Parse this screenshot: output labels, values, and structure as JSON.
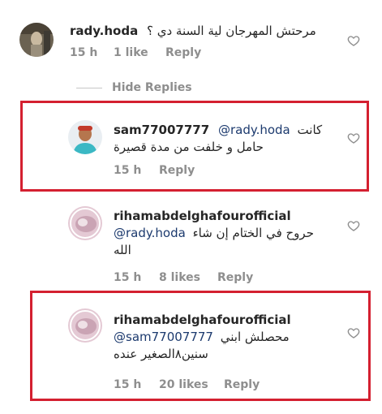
{
  "hide_replies_label": "Hide Replies",
  "comments": [
    {
      "username": "rady.hoda",
      "text": "مرحتش المهرجان لية السنة دي ؟",
      "time": "15 h",
      "likes": "1 like",
      "reply": "Reply"
    },
    {
      "username": "sam77007777",
      "mention": "@rady.hoda",
      "text_line1": "كانت",
      "text_line2": "حامل و خلفت من مدة قصيرة",
      "time": "15 h",
      "reply": "Reply"
    },
    {
      "username": "rihamabdelghafourofficial",
      "mention": "@rady.hoda",
      "text_line1": "حروح في الختام إن شاء",
      "text_line2": "الله",
      "time": "15 h",
      "likes": "8 likes",
      "reply": "Reply"
    },
    {
      "username": "rihamabdelghafourofficial",
      "mention": "@sam77007777",
      "text_line1": "محصلش ابني",
      "text_line2": "سنين٨الصغير عنده",
      "time": "15 h",
      "likes": "20 likes",
      "reply": "Reply"
    }
  ],
  "icons": {
    "like": "heart-outline-icon"
  },
  "colors": {
    "highlight": "#d42030",
    "meta": "#8e8e8e",
    "mention": "#1c3a6e"
  }
}
